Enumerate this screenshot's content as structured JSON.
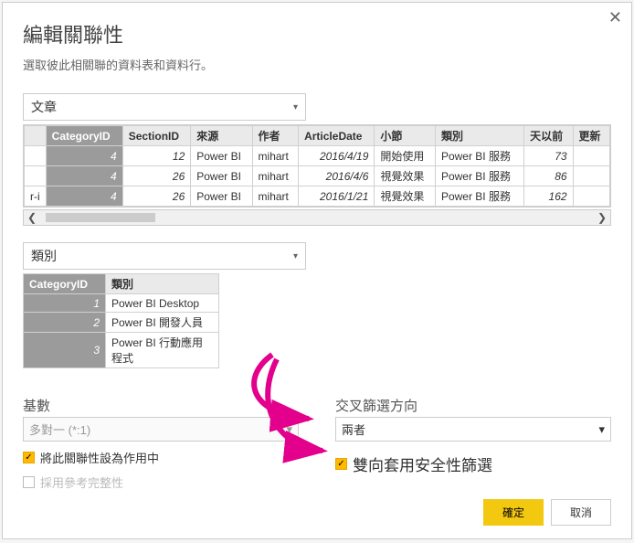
{
  "dialog": {
    "title": "編輯關聯性",
    "subtitle": "選取彼此相關聯的資料表和資料行。",
    "close": "✕"
  },
  "table1": {
    "dropdown": "文章",
    "headers": {
      "c0": "CategoryID",
      "c1": "SectionID",
      "c2": "來源",
      "c3": "作者",
      "c4": "ArticleDate",
      "c5": "小節",
      "c6": "類別",
      "c7": "天以前",
      "c8": "更新"
    },
    "rows": [
      {
        "c0": "4",
        "c1": "12",
        "c2": "Power BI",
        "c3": "mihart",
        "c4": "2016/4/19",
        "c5": "開始使用",
        "c6": "Power BI 服務",
        "c7": "73",
        "c8": ""
      },
      {
        "c0": "4",
        "c1": "26",
        "c2": "Power BI",
        "c3": "mihart",
        "c4": "2016/4/6",
        "c5": "視覺效果",
        "c6": "Power BI 服務",
        "c7": "86",
        "c8": ""
      },
      {
        "pre": "r-i",
        "c0": "4",
        "c1": "26",
        "c2": "Power BI",
        "c3": "mihart",
        "c4": "2016/1/21",
        "c5": "視覺效果",
        "c6": "Power BI 服務",
        "c7": "162",
        "c8": ""
      }
    ]
  },
  "table2": {
    "dropdown": "類別",
    "headers": {
      "c0": "CategoryID",
      "c1": "類別"
    },
    "rows": [
      {
        "c0": "1",
        "c1": "Power BI Desktop"
      },
      {
        "c0": "2",
        "c1": "Power BI 開發人員"
      },
      {
        "c0": "3",
        "c1": "Power BI 行動應用程式"
      }
    ]
  },
  "options": {
    "cardinality_label": "基數",
    "cardinality_value": "多對一 (*:1)",
    "crossfilter_label": "交叉篩選方向",
    "crossfilter_value": "兩者",
    "chk_active": "將此關聯性設為作用中",
    "chk_integrity": "採用參考完整性",
    "chk_bidir": "雙向套用安全性篩選"
  },
  "buttons": {
    "ok": "確定",
    "cancel": "取消"
  },
  "icons": {
    "caret": "▾",
    "left": "❮",
    "right": "❯",
    "check": "✓"
  }
}
